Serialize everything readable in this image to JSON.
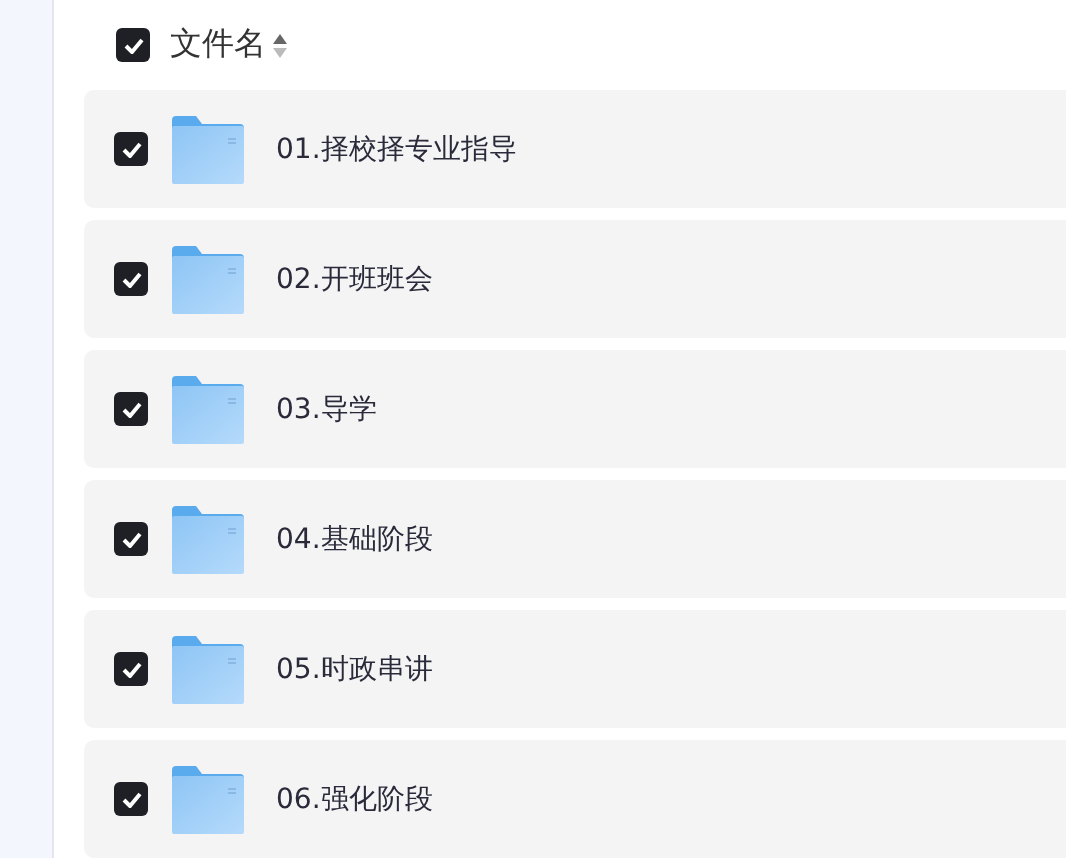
{
  "header": {
    "label": "文件名",
    "checked": true
  },
  "files": [
    {
      "name": "01.择校择专业指导",
      "checked": true
    },
    {
      "name": "02.开班班会",
      "checked": true
    },
    {
      "name": "03.导学",
      "checked": true
    },
    {
      "name": "04.基础阶段",
      "checked": true
    },
    {
      "name": "05.时政串讲",
      "checked": true
    },
    {
      "name": "06.强化阶段",
      "checked": true
    }
  ]
}
